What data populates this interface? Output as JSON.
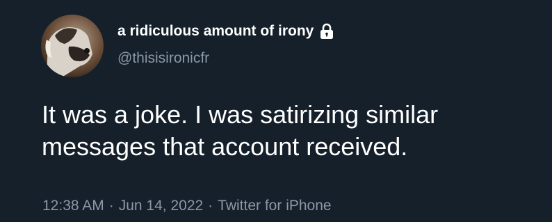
{
  "tweet": {
    "author": {
      "display_name": "a ridiculous amount of irony",
      "handle": "@thisisironicfr",
      "protected_icon": "lock-icon",
      "avatar_icon": "profile-photo"
    },
    "text_lines": [
      "It was a joke. I was satirizing similar",
      "messages that account received."
    ],
    "meta": {
      "time": "12:38 AM",
      "separator": "·",
      "date": "Jun 14, 2022",
      "source": "Twitter for iPhone"
    }
  },
  "colors": {
    "background": "#15202b",
    "primary_text": "#ffffff",
    "secondary_text": "#8b98a5"
  }
}
